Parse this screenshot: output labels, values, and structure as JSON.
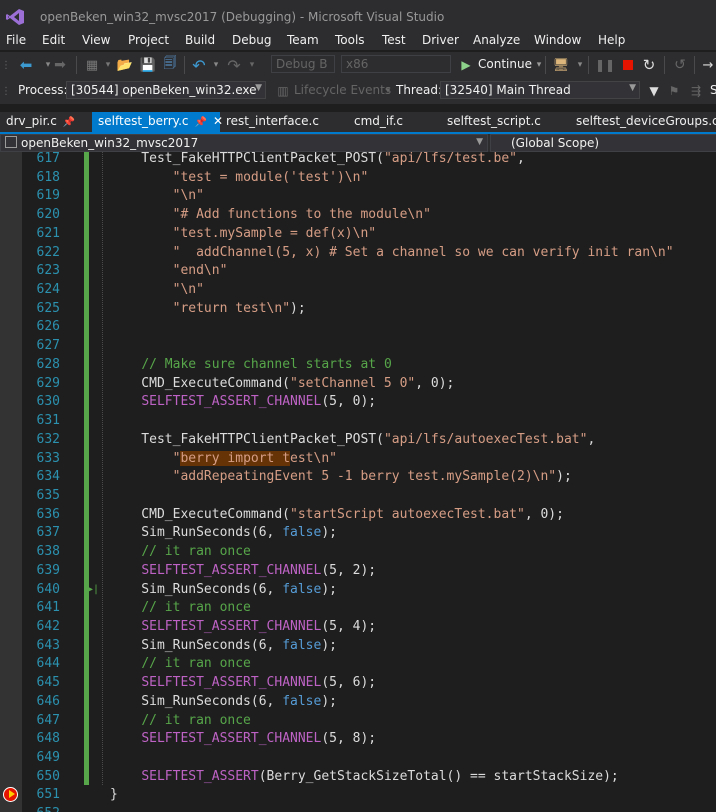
{
  "window": {
    "title": "openBeken_win32_mvsc2017 (Debugging) - Microsoft Visual Studio"
  },
  "menu": [
    "File",
    "Edit",
    "View",
    "Project",
    "Build",
    "Debug",
    "Team",
    "Tools",
    "Test",
    "Driver",
    "Analyze",
    "Window",
    "Help"
  ],
  "toolbar": {
    "config": "Debug B",
    "platform": "x86",
    "continue_label": "Continue",
    "process_label": "Process:",
    "process_value": "[30544] openBeken_win32.exe",
    "lifecycle_label": "Lifecycle Events",
    "thread_label": "Thread:",
    "thread_value": "[32540] Main Thread"
  },
  "tabs": [
    {
      "label": "drv_pir.c",
      "pinned": true,
      "active": false
    },
    {
      "label": "selftest_berry.c",
      "pinned": true,
      "active": true
    },
    {
      "label": "rest_interface.c",
      "pinned": false,
      "active": false
    },
    {
      "label": "cmd_if.c",
      "pinned": false,
      "active": false
    },
    {
      "label": "selftest_script.c",
      "pinned": false,
      "active": false
    },
    {
      "label": "selftest_deviceGroups.c",
      "pinned": false,
      "active": false
    }
  ],
  "navbar": {
    "project": "openBeken_win32_mvsc2017",
    "scope": "(Global Scope)"
  },
  "code": {
    "lines": [
      {
        "n": "617",
        "text": "    Test_FakeHTTPClientPacket_POST(\"api/lfs/test.be\","
      },
      {
        "n": "618",
        "text": "        \"test = module('test')\\n\""
      },
      {
        "n": "619",
        "text": "        \"\\n\""
      },
      {
        "n": "620",
        "text": "        \"# Add functions to the module\\n\""
      },
      {
        "n": "621",
        "text": "        \"test.mySample = def(x)\\n\""
      },
      {
        "n": "622",
        "text": "        \"  addChannel(5, x) # Set a channel so we can verify init ran\\n\""
      },
      {
        "n": "623",
        "text": "        \"end\\n\""
      },
      {
        "n": "624",
        "text": "        \"\\n\""
      },
      {
        "n": "625",
        "text": "        \"return test\\n\");"
      },
      {
        "n": "626",
        "text": ""
      },
      {
        "n": "627",
        "text": ""
      },
      {
        "n": "628",
        "text": "    // Make sure channel starts at 0"
      },
      {
        "n": "629",
        "text": "    CMD_ExecuteCommand(\"setChannel 5 0\", 0);"
      },
      {
        "n": "630",
        "text": "    SELFTEST_ASSERT_CHANNEL(5, 0);"
      },
      {
        "n": "631",
        "text": ""
      },
      {
        "n": "632",
        "text": "    Test_FakeHTTPClientPacket_POST(\"api/lfs/autoexecTest.bat\","
      },
      {
        "n": "633",
        "text": "        \"berry import test\\n\""
      },
      {
        "n": "634",
        "text": "        \"addRepeatingEvent 5 -1 berry test.mySample(2)\\n\");"
      },
      {
        "n": "635",
        "text": ""
      },
      {
        "n": "636",
        "text": "    CMD_ExecuteCommand(\"startScript autoexecTest.bat\", 0);"
      },
      {
        "n": "637",
        "text": "    Sim_RunSeconds(6, false);"
      },
      {
        "n": "638",
        "text": "    // it ran once"
      },
      {
        "n": "639",
        "text": "    SELFTEST_ASSERT_CHANNEL(5, 2);"
      },
      {
        "n": "640",
        "text": "    Sim_RunSeconds(6, false);"
      },
      {
        "n": "641",
        "text": "    // it ran once"
      },
      {
        "n": "642",
        "text": "    SELFTEST_ASSERT_CHANNEL(5, 4);"
      },
      {
        "n": "643",
        "text": "    Sim_RunSeconds(6, false);"
      },
      {
        "n": "644",
        "text": "    // it ran once"
      },
      {
        "n": "645",
        "text": "    SELFTEST_ASSERT_CHANNEL(5, 6);"
      },
      {
        "n": "646",
        "text": "    Sim_RunSeconds(6, false);"
      },
      {
        "n": "647",
        "text": "    // it ran once"
      },
      {
        "n": "648",
        "text": "    SELFTEST_ASSERT_CHANNEL(5, 8);"
      },
      {
        "n": "649",
        "text": ""
      },
      {
        "n": "650",
        "text": "    SELFTEST_ASSERT(Berry_GetStackSizeTotal() == startStackSize);"
      },
      {
        "n": "651",
        "text": "}"
      },
      {
        "n": "652",
        "text": ""
      }
    ],
    "breakpoint_line": "651",
    "run_to_click_line": "640"
  },
  "colors": {
    "accent": "#007acc",
    "string": "#d69d85",
    "comment": "#57a64a",
    "macro": "#be63c5",
    "keyword": "#569cd6",
    "line_number": "#2b91af",
    "highlight": "#653306",
    "breakpoint": "#e51400"
  }
}
